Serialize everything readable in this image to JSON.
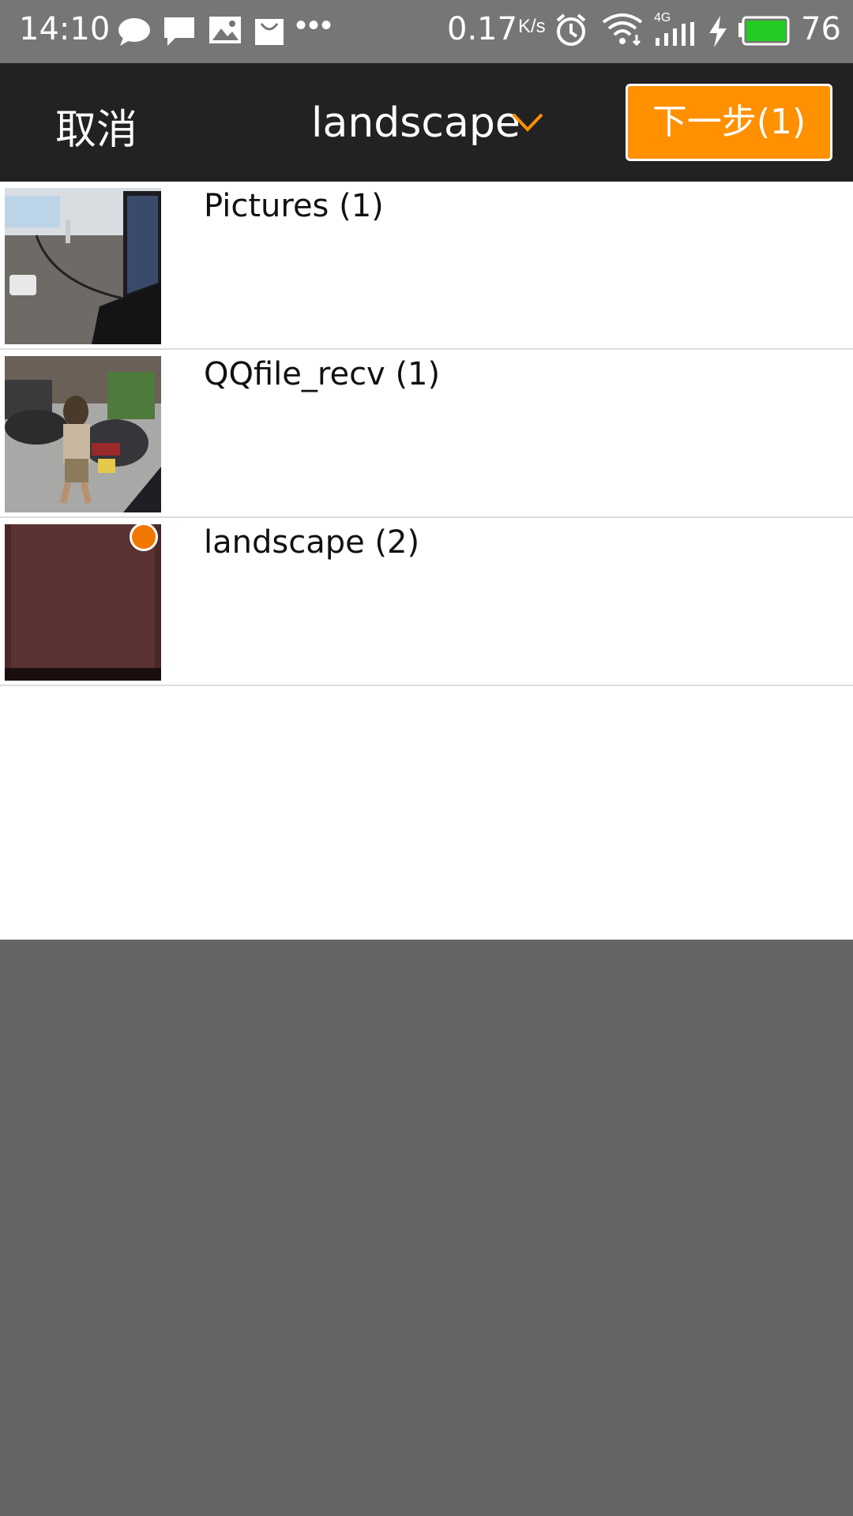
{
  "status_bar": {
    "time": "14:10",
    "speed_value": "0.17",
    "speed_unit": "K/s",
    "network": "4G",
    "battery": "76",
    "battery_fraction": 0.76,
    "icons": [
      "chat-bubble-icon",
      "message-icon",
      "image-icon",
      "shopping-bag-icon",
      "more-icon",
      "alarm-icon",
      "wifi-icon",
      "signal-icon",
      "charging-icon",
      "battery-icon"
    ]
  },
  "header": {
    "cancel_label": "取消",
    "title": "landscape",
    "next_label": "下一步(1)"
  },
  "albums": [
    {
      "label": "Pictures (1)",
      "selected": false
    },
    {
      "label": "QQfile_recv (1)",
      "selected": false
    },
    {
      "label": "landscape (2)",
      "selected": true
    }
  ],
  "colors": {
    "accent": "#ff9000",
    "header_bg": "#222222",
    "statusbar_bg": "#767676",
    "overlay_bg": "#656565",
    "selected_dot": "#f07800"
  }
}
